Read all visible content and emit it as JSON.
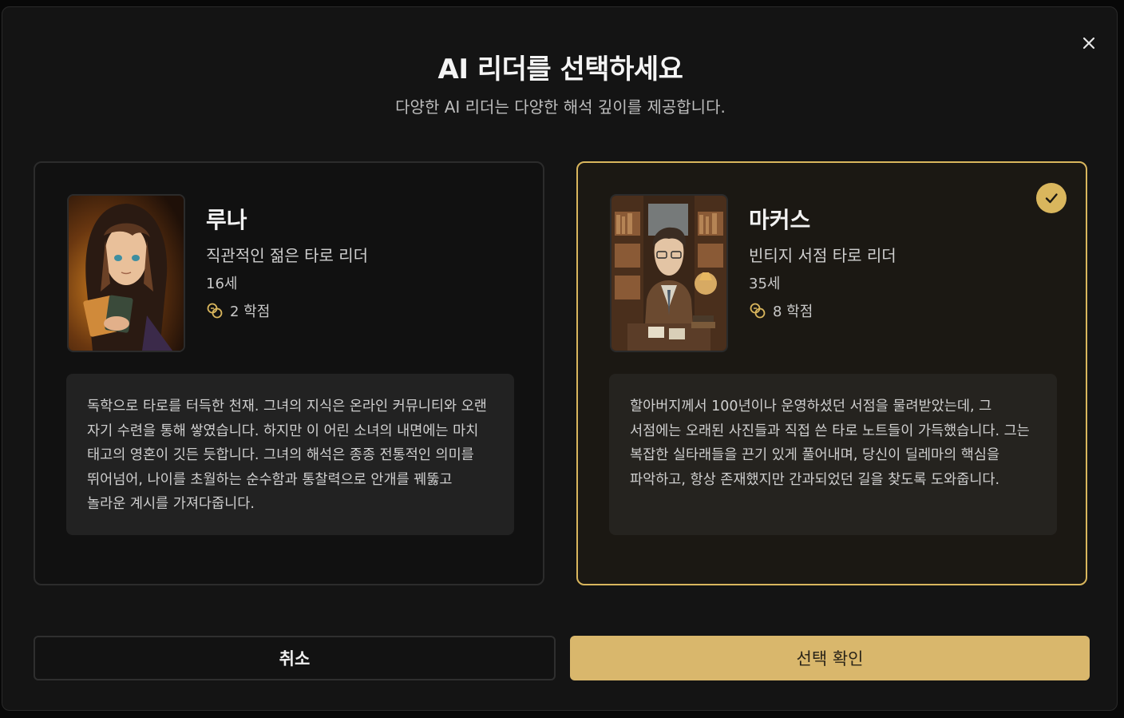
{
  "modal": {
    "title": "AI 리더를 선택하세요",
    "subtitle": "다양한 AI 리더는 다양한 해석 깊이를 제공합니다."
  },
  "readers": [
    {
      "name": "루나",
      "role": "직관적인 젊은 타로 리더",
      "age": "16세",
      "credits": "2 학점",
      "description": "독학으로 타로를 터득한 천재. 그녀의 지식은 온라인 커뮤니티와 오랜 자기 수련을 통해 쌓였습니다. 하지만 이 어린 소녀의 내면에는 마치 태고의 영혼이 깃든 듯합니다. 그녀의 해석은 종종 전통적인 의미를 뛰어넘어, 나이를 초월하는 순수함과 통찰력으로 안개를 꿰뚫고 놀라운 계시를 가져다줍니다.",
      "selected": false
    },
    {
      "name": "마커스",
      "role": "빈티지 서점 타로 리더",
      "age": "35세",
      "credits": "8 학점",
      "description": "할아버지께서 100년이나 운영하셨던 서점을 물려받았는데, 그 서점에는 오래된 사진들과 직접 쓴 타로 노트들이 가득했습니다. 그는 복잡한 실타래들을 끈기 있게 풀어내며, 당신이 딜레마의 핵심을 파악하고, 항상 존재했지만 간과되었던 길을 찾도록 도와줍니다.",
      "selected": true
    }
  ],
  "buttons": {
    "cancel": "취소",
    "confirm": "선택 확인"
  },
  "icons": {
    "close": "close-icon",
    "credit": "coins-icon",
    "selected": "check-icon"
  },
  "colors": {
    "accent": "#d9b65d",
    "background": "#141414"
  }
}
